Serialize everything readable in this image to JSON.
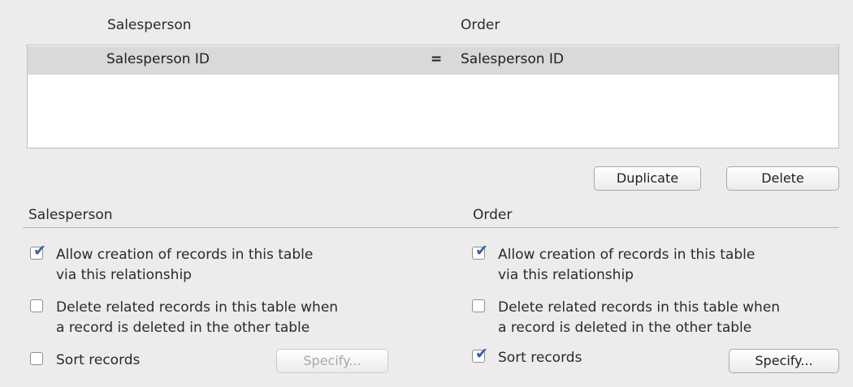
{
  "top": {
    "left_table": "Salesperson",
    "right_table": "Order"
  },
  "relationship": {
    "left_field": "Salesperson ID",
    "operator": "=",
    "right_field": "Salesperson ID"
  },
  "actions": {
    "duplicate": "Duplicate",
    "delete": "Delete"
  },
  "left_panel": {
    "title": "Salesperson",
    "allow_creation_line1": "Allow creation of records in this table",
    "allow_creation_line2": "via this relationship",
    "allow_creation_checked": true,
    "delete_related_line1": "Delete related records in this table when",
    "delete_related_line2": "a record is deleted in the other table",
    "delete_related_checked": false,
    "sort_label": "Sort records",
    "sort_checked": false,
    "specify": "Specify...",
    "specify_enabled": false
  },
  "right_panel": {
    "title": "Order",
    "allow_creation_line1": "Allow creation of records in this table",
    "allow_creation_line2": "via this relationship",
    "allow_creation_checked": true,
    "delete_related_line1": "Delete related records in this table when",
    "delete_related_line2": "a record is deleted in the other table",
    "delete_related_checked": false,
    "sort_label": "Sort records",
    "sort_checked": true,
    "specify": "Specify...",
    "specify_enabled": true
  },
  "colors": {
    "checkmark": "#3a5fa0",
    "selected_row": "#d9d9d9"
  },
  "icons": {
    "checkmark": "checkmark-icon"
  }
}
